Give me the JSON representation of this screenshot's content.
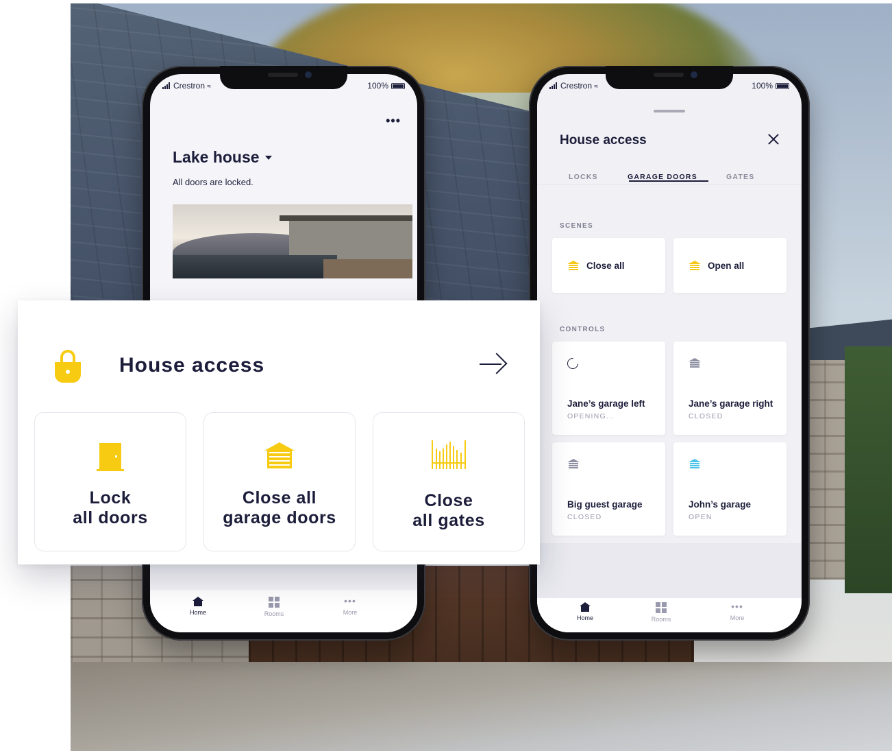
{
  "phone_left": {
    "status": {
      "carrier": "Crestron",
      "battery": "100%"
    },
    "title": "Lake house",
    "subtitle": "All doors are locked.",
    "tabbar": [
      {
        "label": "Home",
        "icon": "home-icon",
        "active": true
      },
      {
        "label": "Rooms",
        "icon": "rooms-icon",
        "active": false
      },
      {
        "label": "More",
        "icon": "more-icon",
        "active": false
      }
    ]
  },
  "phone_right": {
    "status": {
      "carrier": "Crestron",
      "battery": "100%"
    },
    "title": "House access",
    "tabs": [
      {
        "label": "LOCKS",
        "active": false
      },
      {
        "label": "GARAGE DOORS",
        "active": true
      },
      {
        "label": "GATES",
        "active": false
      }
    ],
    "scenes_label": "SCENES",
    "scenes": [
      {
        "label": "Close all",
        "icon": "garage-closed-icon"
      },
      {
        "label": "Open all",
        "icon": "garage-open-icon"
      }
    ],
    "controls_label": "CONTROLS",
    "controls": [
      {
        "name": "Jane’s garage left",
        "state": "OPENING...",
        "icon": "spinner-icon"
      },
      {
        "name": "Jane’s garage right",
        "state": "CLOSED",
        "icon": "garage-icon"
      },
      {
        "name": "Big guest garage",
        "state": "CLOSED",
        "icon": "garage-icon"
      },
      {
        "name": "John’s garage",
        "state": "OPEN",
        "icon": "garage-open-icon"
      }
    ],
    "tabbar": [
      {
        "label": "Home",
        "active": true
      },
      {
        "label": "Rooms",
        "active": false
      },
      {
        "label": "More",
        "active": false
      }
    ]
  },
  "access_card": {
    "title": "House access",
    "tiles": [
      {
        "line1": "Lock",
        "line2": "all doors",
        "icon": "door-icon"
      },
      {
        "line1": "Close all",
        "line2": "garage doors",
        "icon": "garage-door-icon"
      },
      {
        "line1": "Close",
        "line2": "all gates",
        "icon": "gate-icon"
      }
    ]
  },
  "colors": {
    "accent_yellow": "#f7cb12",
    "open_blue": "#4ec3ea",
    "text_dark": "#1c1d3a",
    "muted": "#9a9aae"
  }
}
